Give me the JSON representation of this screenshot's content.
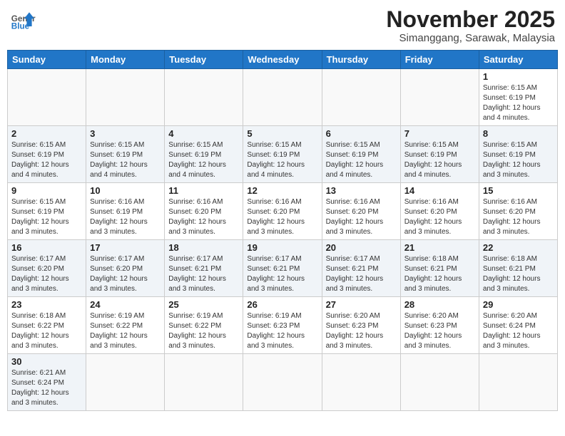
{
  "header": {
    "logo_general": "General",
    "logo_blue": "Blue",
    "month_title": "November 2025",
    "location": "Simanggang, Sarawak, Malaysia"
  },
  "weekdays": [
    "Sunday",
    "Monday",
    "Tuesday",
    "Wednesday",
    "Thursday",
    "Friday",
    "Saturday"
  ],
  "weeks": [
    [
      {
        "day": "",
        "info": ""
      },
      {
        "day": "",
        "info": ""
      },
      {
        "day": "",
        "info": ""
      },
      {
        "day": "",
        "info": ""
      },
      {
        "day": "",
        "info": ""
      },
      {
        "day": "",
        "info": ""
      },
      {
        "day": "1",
        "info": "Sunrise: 6:15 AM\nSunset: 6:19 PM\nDaylight: 12 hours and 4 minutes."
      }
    ],
    [
      {
        "day": "2",
        "info": "Sunrise: 6:15 AM\nSunset: 6:19 PM\nDaylight: 12 hours and 4 minutes."
      },
      {
        "day": "3",
        "info": "Sunrise: 6:15 AM\nSunset: 6:19 PM\nDaylight: 12 hours and 4 minutes."
      },
      {
        "day": "4",
        "info": "Sunrise: 6:15 AM\nSunset: 6:19 PM\nDaylight: 12 hours and 4 minutes."
      },
      {
        "day": "5",
        "info": "Sunrise: 6:15 AM\nSunset: 6:19 PM\nDaylight: 12 hours and 4 minutes."
      },
      {
        "day": "6",
        "info": "Sunrise: 6:15 AM\nSunset: 6:19 PM\nDaylight: 12 hours and 4 minutes."
      },
      {
        "day": "7",
        "info": "Sunrise: 6:15 AM\nSunset: 6:19 PM\nDaylight: 12 hours and 4 minutes."
      },
      {
        "day": "8",
        "info": "Sunrise: 6:15 AM\nSunset: 6:19 PM\nDaylight: 12 hours and 3 minutes."
      }
    ],
    [
      {
        "day": "9",
        "info": "Sunrise: 6:15 AM\nSunset: 6:19 PM\nDaylight: 12 hours and 3 minutes."
      },
      {
        "day": "10",
        "info": "Sunrise: 6:16 AM\nSunset: 6:19 PM\nDaylight: 12 hours and 3 minutes."
      },
      {
        "day": "11",
        "info": "Sunrise: 6:16 AM\nSunset: 6:20 PM\nDaylight: 12 hours and 3 minutes."
      },
      {
        "day": "12",
        "info": "Sunrise: 6:16 AM\nSunset: 6:20 PM\nDaylight: 12 hours and 3 minutes."
      },
      {
        "day": "13",
        "info": "Sunrise: 6:16 AM\nSunset: 6:20 PM\nDaylight: 12 hours and 3 minutes."
      },
      {
        "day": "14",
        "info": "Sunrise: 6:16 AM\nSunset: 6:20 PM\nDaylight: 12 hours and 3 minutes."
      },
      {
        "day": "15",
        "info": "Sunrise: 6:16 AM\nSunset: 6:20 PM\nDaylight: 12 hours and 3 minutes."
      }
    ],
    [
      {
        "day": "16",
        "info": "Sunrise: 6:17 AM\nSunset: 6:20 PM\nDaylight: 12 hours and 3 minutes."
      },
      {
        "day": "17",
        "info": "Sunrise: 6:17 AM\nSunset: 6:20 PM\nDaylight: 12 hours and 3 minutes."
      },
      {
        "day": "18",
        "info": "Sunrise: 6:17 AM\nSunset: 6:21 PM\nDaylight: 12 hours and 3 minutes."
      },
      {
        "day": "19",
        "info": "Sunrise: 6:17 AM\nSunset: 6:21 PM\nDaylight: 12 hours and 3 minutes."
      },
      {
        "day": "20",
        "info": "Sunrise: 6:17 AM\nSunset: 6:21 PM\nDaylight: 12 hours and 3 minutes."
      },
      {
        "day": "21",
        "info": "Sunrise: 6:18 AM\nSunset: 6:21 PM\nDaylight: 12 hours and 3 minutes."
      },
      {
        "day": "22",
        "info": "Sunrise: 6:18 AM\nSunset: 6:21 PM\nDaylight: 12 hours and 3 minutes."
      }
    ],
    [
      {
        "day": "23",
        "info": "Sunrise: 6:18 AM\nSunset: 6:22 PM\nDaylight: 12 hours and 3 minutes."
      },
      {
        "day": "24",
        "info": "Sunrise: 6:19 AM\nSunset: 6:22 PM\nDaylight: 12 hours and 3 minutes."
      },
      {
        "day": "25",
        "info": "Sunrise: 6:19 AM\nSunset: 6:22 PM\nDaylight: 12 hours and 3 minutes."
      },
      {
        "day": "26",
        "info": "Sunrise: 6:19 AM\nSunset: 6:23 PM\nDaylight: 12 hours and 3 minutes."
      },
      {
        "day": "27",
        "info": "Sunrise: 6:20 AM\nSunset: 6:23 PM\nDaylight: 12 hours and 3 minutes."
      },
      {
        "day": "28",
        "info": "Sunrise: 6:20 AM\nSunset: 6:23 PM\nDaylight: 12 hours and 3 minutes."
      },
      {
        "day": "29",
        "info": "Sunrise: 6:20 AM\nSunset: 6:24 PM\nDaylight: 12 hours and 3 minutes."
      }
    ],
    [
      {
        "day": "30",
        "info": "Sunrise: 6:21 AM\nSunset: 6:24 PM\nDaylight: 12 hours and 3 minutes."
      },
      {
        "day": "",
        "info": ""
      },
      {
        "day": "",
        "info": ""
      },
      {
        "day": "",
        "info": ""
      },
      {
        "day": "",
        "info": ""
      },
      {
        "day": "",
        "info": ""
      },
      {
        "day": "",
        "info": ""
      }
    ]
  ]
}
